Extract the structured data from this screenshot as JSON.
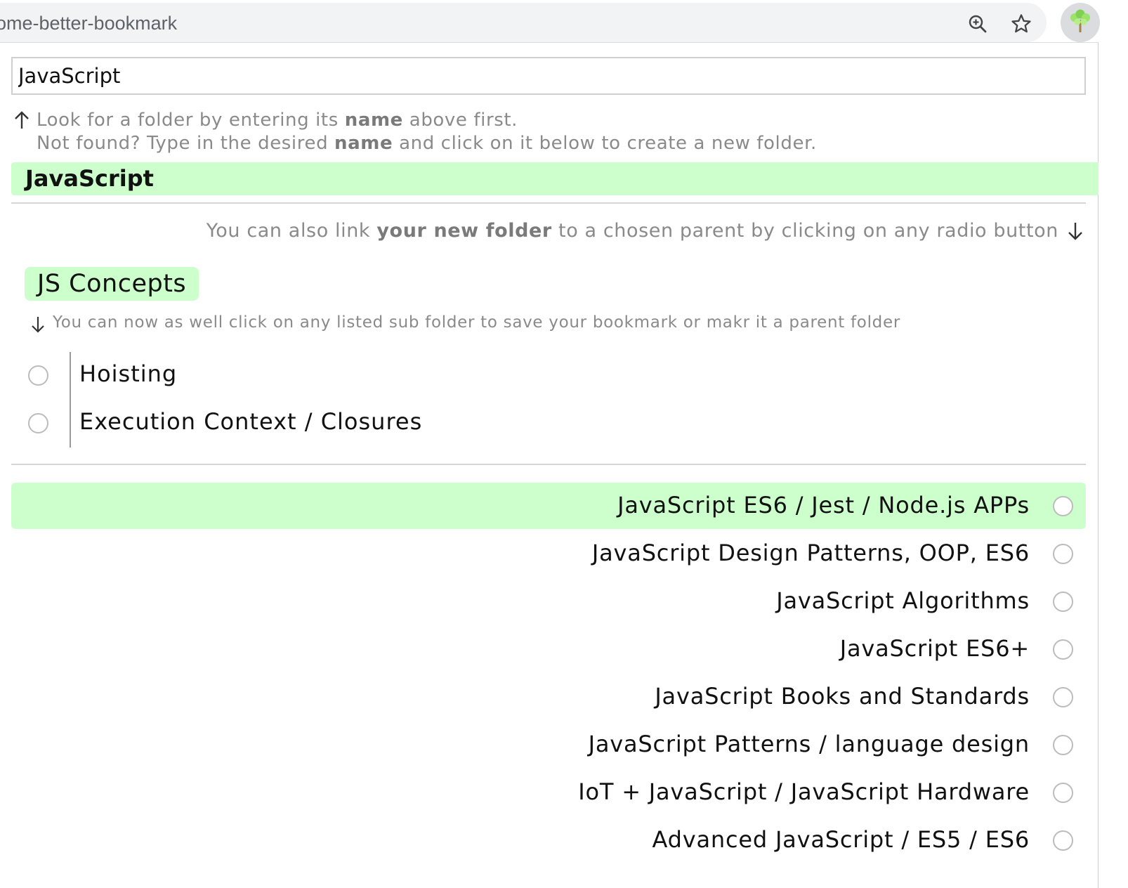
{
  "toolbar": {
    "url_text": "ome-better-bookmark",
    "icons": {
      "zoom": "zoom-in-icon",
      "star": "bookmark-star-icon",
      "extension": "tree-extension-icon"
    }
  },
  "popup": {
    "search": {
      "value": "JavaScript",
      "placeholder": ""
    },
    "hint_line1": {
      "pre": "Look for a folder by entering its ",
      "bold": "name",
      "post": " above first."
    },
    "hint_line2": {
      "pre": "Not found? Type in the desired ",
      "bold": "name",
      "post": " and click on it below to create a new folder."
    },
    "new_folder_name": "JavaScript",
    "link_hint": {
      "pre": "You can also link ",
      "bold": "your new folder",
      "post": " to a chosen parent by clicking on any radio button"
    },
    "parent_folder": "JS Concepts",
    "sub_hint": "You can now as well click on any listed sub folder to save your bookmark or makr it a parent folder",
    "subfolders": [
      {
        "label": "Hoisting"
      },
      {
        "label": "Execution Context / Closures"
      }
    ],
    "folders": [
      {
        "label": "JavaScript ES6 / Jest / Node.js APPs",
        "highlighted": true
      },
      {
        "label": "JavaScript Design Patterns, OOP, ES6",
        "highlighted": false
      },
      {
        "label": "JavaScript Algorithms",
        "highlighted": false
      },
      {
        "label": "JavaScript ES6+",
        "highlighted": false
      },
      {
        "label": "JavaScript Books and Standards",
        "highlighted": false
      },
      {
        "label": "JavaScript Patterns / language design",
        "highlighted": false
      },
      {
        "label": "IoT + JavaScript / JavaScript Hardware",
        "highlighted": false
      },
      {
        "label": "Advanced JavaScript / ES5 / ES6",
        "highlighted": false
      }
    ],
    "colors": {
      "highlight": "#ccffcc",
      "hint": "#8a8a8a",
      "radio_border": "#bcbcbc"
    }
  }
}
